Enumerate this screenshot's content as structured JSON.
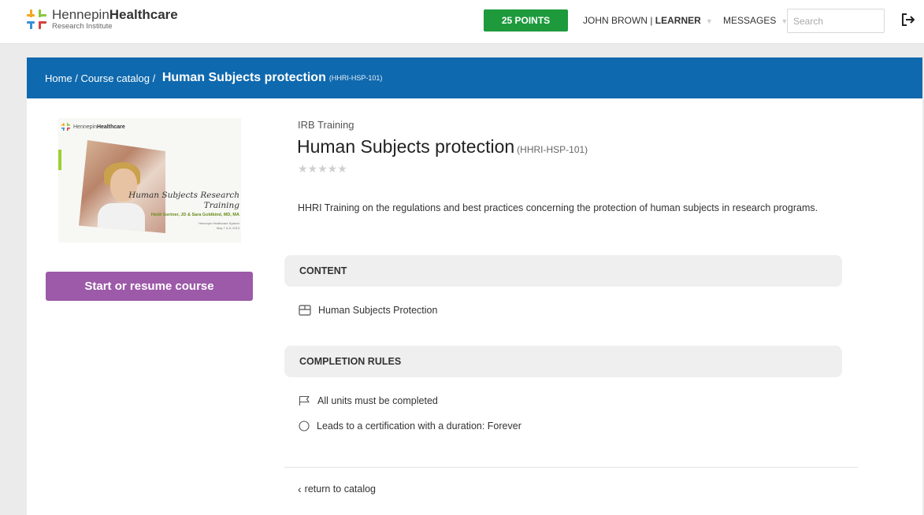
{
  "header": {
    "logo": {
      "name_regular": "Hennepin",
      "name_bold": "Healthcare",
      "subtitle": "Research Institute"
    },
    "points_label": "25 POINTS",
    "user_name": "JOHN BROWN",
    "user_separator": " | ",
    "user_role": "LEARNER",
    "messages_label": "MESSAGES",
    "search_placeholder": "Search",
    "logout_icon": "logout-icon"
  },
  "breadcrumb": {
    "home": "Home",
    "separator": " / ",
    "catalog": "Course catalog",
    "current": "Human Subjects protection",
    "code": "(HHRI-HSP-101)"
  },
  "thumbnail": {
    "logo_regular": "Hennepin",
    "logo_bold": "Healthcare",
    "title_line1": "Human Subjects Research",
    "title_line2": "Training",
    "authors": "Heidi Gertner, JD & Sara Goldkind, MD, MA",
    "org_line1": "Hennepin Healthcare System",
    "org_line2": "May 7 & 8, 2013"
  },
  "start_button_label": "Start or resume course",
  "course": {
    "category": "IRB Training",
    "title": "Human Subjects protection",
    "code": "(HHRI-HSP-101)",
    "rating_stars": "★★★★★",
    "rating": 0,
    "rating_max": 5,
    "description": "HHRI Training on the regulations and best practices concerning the protection of human subjects in research programs."
  },
  "content_section": {
    "heading": "CONTENT",
    "units": [
      {
        "label": "Human Subjects Protection",
        "icon": "unit-icon"
      }
    ]
  },
  "completion_section": {
    "heading": "COMPLETION RULES",
    "rules": [
      {
        "label": "All units must be completed",
        "icon": "flag-icon"
      },
      {
        "label": "Leads to a certification with a duration: Forever",
        "icon": "circle-icon"
      }
    ]
  },
  "return_link": {
    "chevron": "‹",
    "label": "return to catalog"
  },
  "colors": {
    "points_green": "#1e9a3d",
    "breadcrumb_blue": "#0f69ae",
    "start_button_purple": "#9c5aa8",
    "section_header_gray": "#efefef"
  }
}
